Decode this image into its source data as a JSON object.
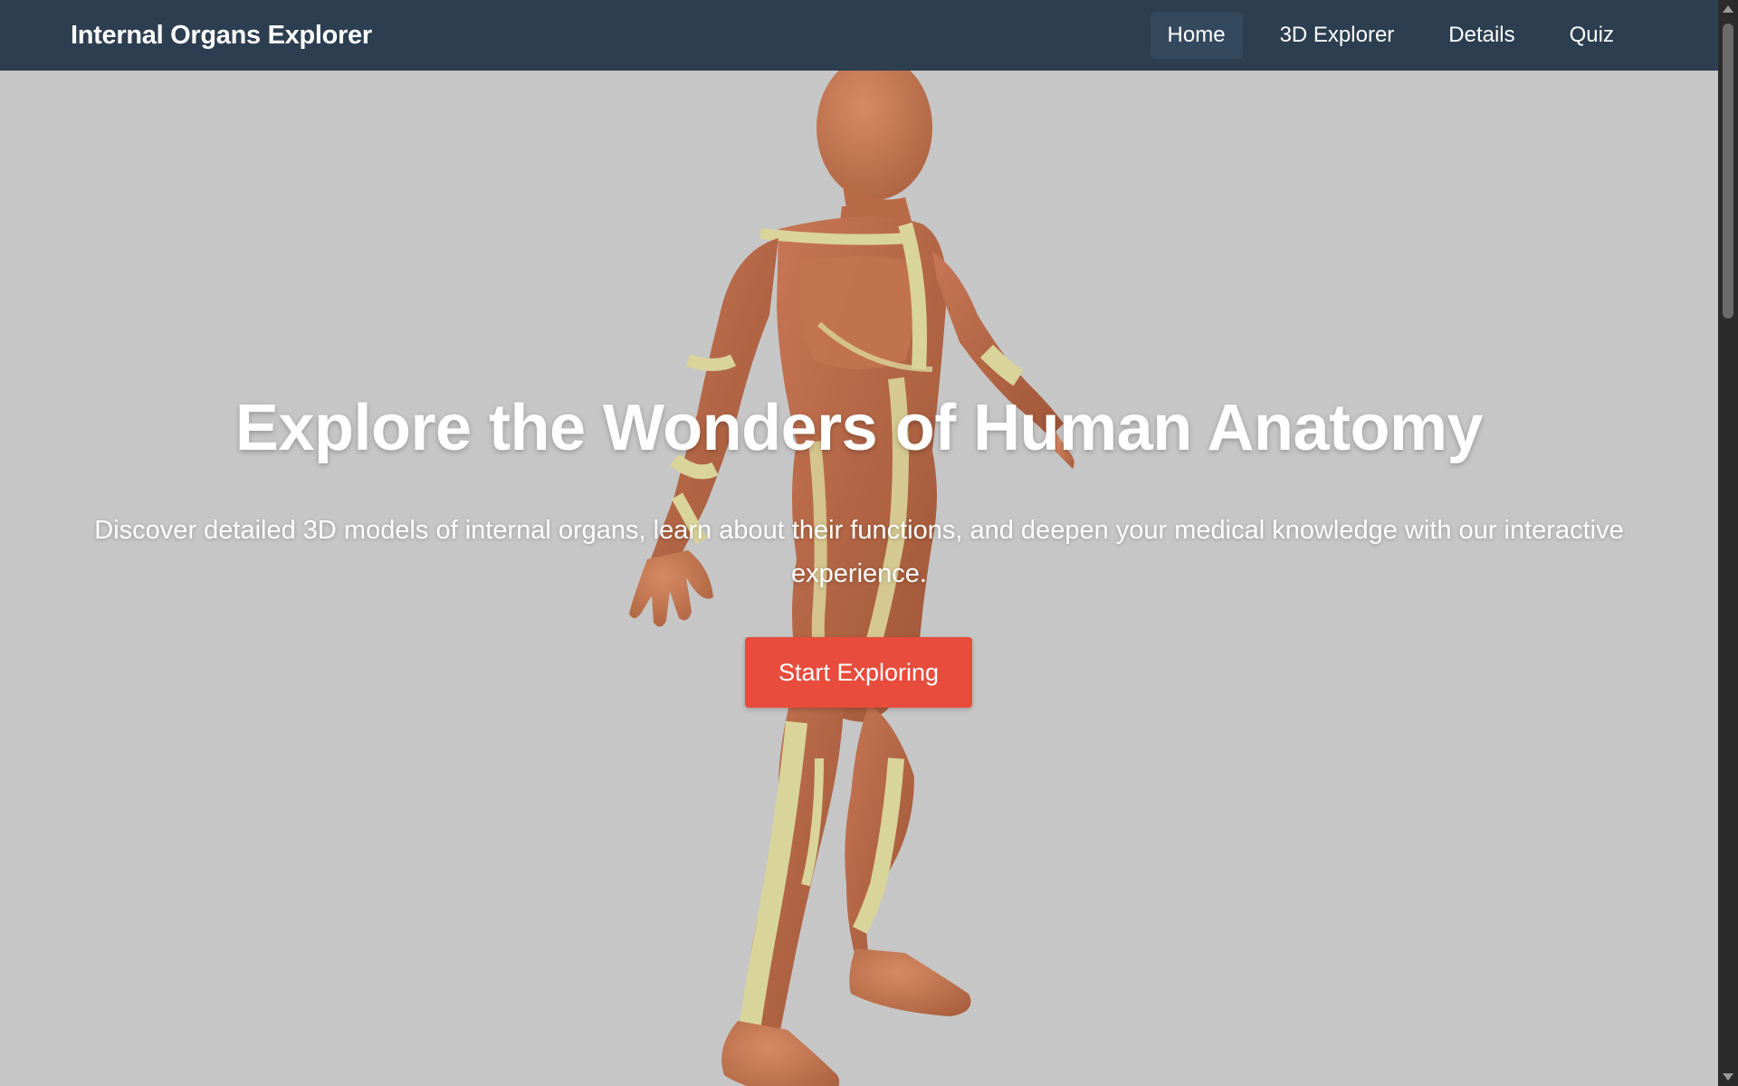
{
  "nav": {
    "brand": "Internal Organs Explorer",
    "links": [
      {
        "label": "Home",
        "active": true
      },
      {
        "label": "3D Explorer",
        "active": false
      },
      {
        "label": "Details",
        "active": false
      },
      {
        "label": "Quiz",
        "active": false
      }
    ]
  },
  "hero": {
    "title": "Explore the Wonders of Human Anatomy",
    "subtitle": "Discover detailed 3D models of internal organs, learn about their functions, and deepen your medical knowledge with our interactive experience.",
    "cta_label": "Start Exploring",
    "model": "anatomy-figure"
  },
  "colors": {
    "navbar": "#2c3e50",
    "nav_active": "#34495e",
    "background": "#c6c6c6",
    "cta": "#e74c3c",
    "skin": "#c97a56",
    "tendon": "#d9d49a"
  }
}
